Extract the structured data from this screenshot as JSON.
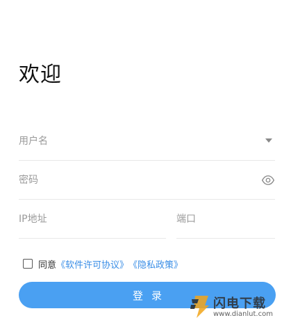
{
  "page": {
    "title": "欢迎"
  },
  "form": {
    "username_placeholder": "用户名",
    "password_placeholder": "密码",
    "ip_placeholder": "IP地址",
    "port_placeholder": "端口",
    "username_icon": "chevron-down-icon",
    "password_icon": "eye-icon"
  },
  "agreement": {
    "checked": false,
    "prefix": "同意",
    "license_link": "《软件许可协议》",
    "privacy_link": "《隐私政策》"
  },
  "login_button": {
    "label": "登录",
    "color": "#4aa0f2"
  },
  "watermark": {
    "title": "闪电下载",
    "url": "www.dianlut.com"
  }
}
